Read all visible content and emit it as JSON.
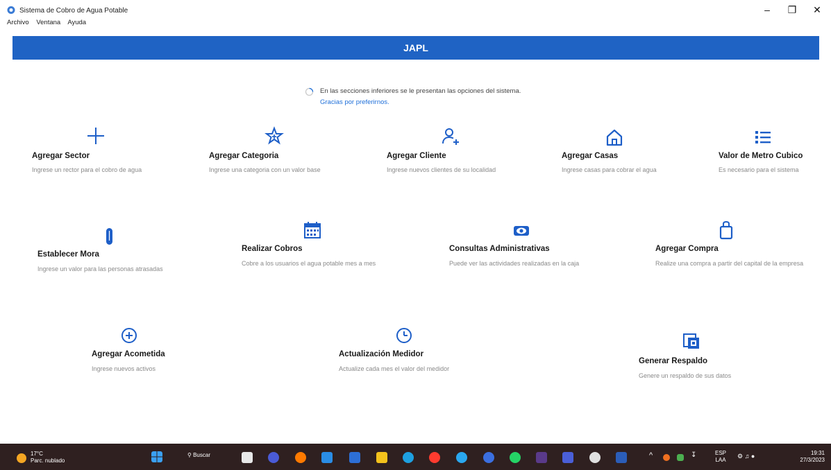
{
  "window": {
    "title": "Sistema de Cobro de Agua Potable",
    "controls": {
      "minimize": "–",
      "maximize": "❐",
      "close": "✕"
    }
  },
  "menu": [
    "Archivo",
    "Ventana",
    "Ayuda"
  ],
  "banner": {
    "title": "JAPL",
    "color": "#1f63c4"
  },
  "info": {
    "line1": "En las secciones inferiores se le presentan las opciones del sistema.",
    "line2": "Gracias por preferirnos."
  },
  "cards": [
    {
      "title": "Agregar Sector",
      "desc": "Ingrese un rector para el cobro de agua",
      "icon": "plus-icon"
    },
    {
      "title": "Agregar Categoria",
      "desc": "Ingrese una categoria con un valor base",
      "icon": "star-icon"
    },
    {
      "title": "Agregar Cliente",
      "desc": "Ingrese nuevos clientes de su localidad",
      "icon": "add-person-icon"
    },
    {
      "title": "Agregar Casas",
      "desc": "Ingrese casas para cobrar el agua",
      "icon": "home-icon"
    },
    {
      "title": "Valor de Metro Cubico",
      "desc": "Es necesario para el sistema",
      "icon": "list-icon"
    },
    {
      "title": "Establecer Mora",
      "desc": "Ingrese un valor para las personas atrasadas",
      "icon": "paperclip-icon"
    },
    {
      "title": "Realizar Cobros",
      "desc": "Cobre a los usuarios el agua potable mes a mes",
      "icon": "calendar-icon"
    },
    {
      "title": "Consultas Administrativas",
      "desc": "Puede ver las actividades realizadas en la caja",
      "icon": "eye-icon"
    },
    {
      "title": "Agregar Compra",
      "desc": "Realize una compra a partir del capital de la empresa",
      "icon": "shopping-bag-icon"
    },
    {
      "title": "Agregar Acometida",
      "desc": "Ingrese nuevos activos",
      "icon": "plus-circle-icon"
    },
    {
      "title": "Actualización Medidor",
      "desc": "Actualize cada mes el valor del medidor",
      "icon": "clock-icon"
    },
    {
      "title": "Generar Respaldo",
      "desc": "Genere un respaldo de sus datos",
      "icon": "backup-icon"
    }
  ],
  "taskbar": {
    "weather_temp": "17°C",
    "weather_desc": "Parc. nublado",
    "search_label": "Buscar",
    "lang_top": "ESP",
    "lang_bottom": "LAA",
    "time": "19:31",
    "date": "27/3/2023"
  },
  "colors": {
    "accent": "#1f63c4",
    "icon": "#1e5fc8",
    "taskbar": "#2f2020"
  }
}
